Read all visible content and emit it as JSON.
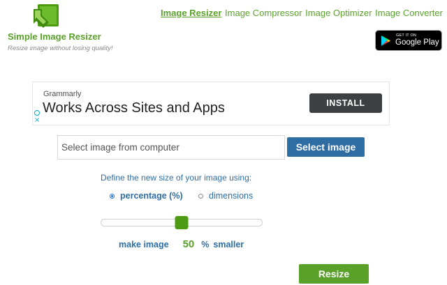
{
  "site": {
    "title": "Simple Image Resizer",
    "tagline": "Resize image without losing quality!",
    "accent_color": "#5aa12a",
    "logo_icon": "green-arrow-logo"
  },
  "nav": {
    "items": [
      {
        "label": "Image Resizer",
        "active": true
      },
      {
        "label": "Image Compressor",
        "active": false
      },
      {
        "label": "Image Optimizer",
        "active": false
      },
      {
        "label": "Image Converter",
        "active": false
      }
    ]
  },
  "google_play": {
    "get_it_on": "GET IT ON",
    "store": "Google Play",
    "icon": "google-play-icon"
  },
  "ad": {
    "brand": "Grammarly",
    "headline": "Works Across Sites and Apps",
    "cta": "INSTALL",
    "info_icon": "adchoices-info-icon",
    "close_icon": "close-icon"
  },
  "upload": {
    "placeholder": "Select image from computer",
    "button_label": "Select image",
    "button_color": "#2e6da4"
  },
  "resize_options": {
    "prompt": "Define the new size of your image using:",
    "options": [
      {
        "label": "percentage (%)",
        "selected": true
      },
      {
        "label": "dimensions",
        "selected": false
      }
    ]
  },
  "slider": {
    "value_percent": 50
  },
  "summary": {
    "prefix": "make image",
    "value": "50",
    "unit": "%",
    "suffix": "smaller"
  },
  "resize_button": {
    "label": "Resize"
  }
}
